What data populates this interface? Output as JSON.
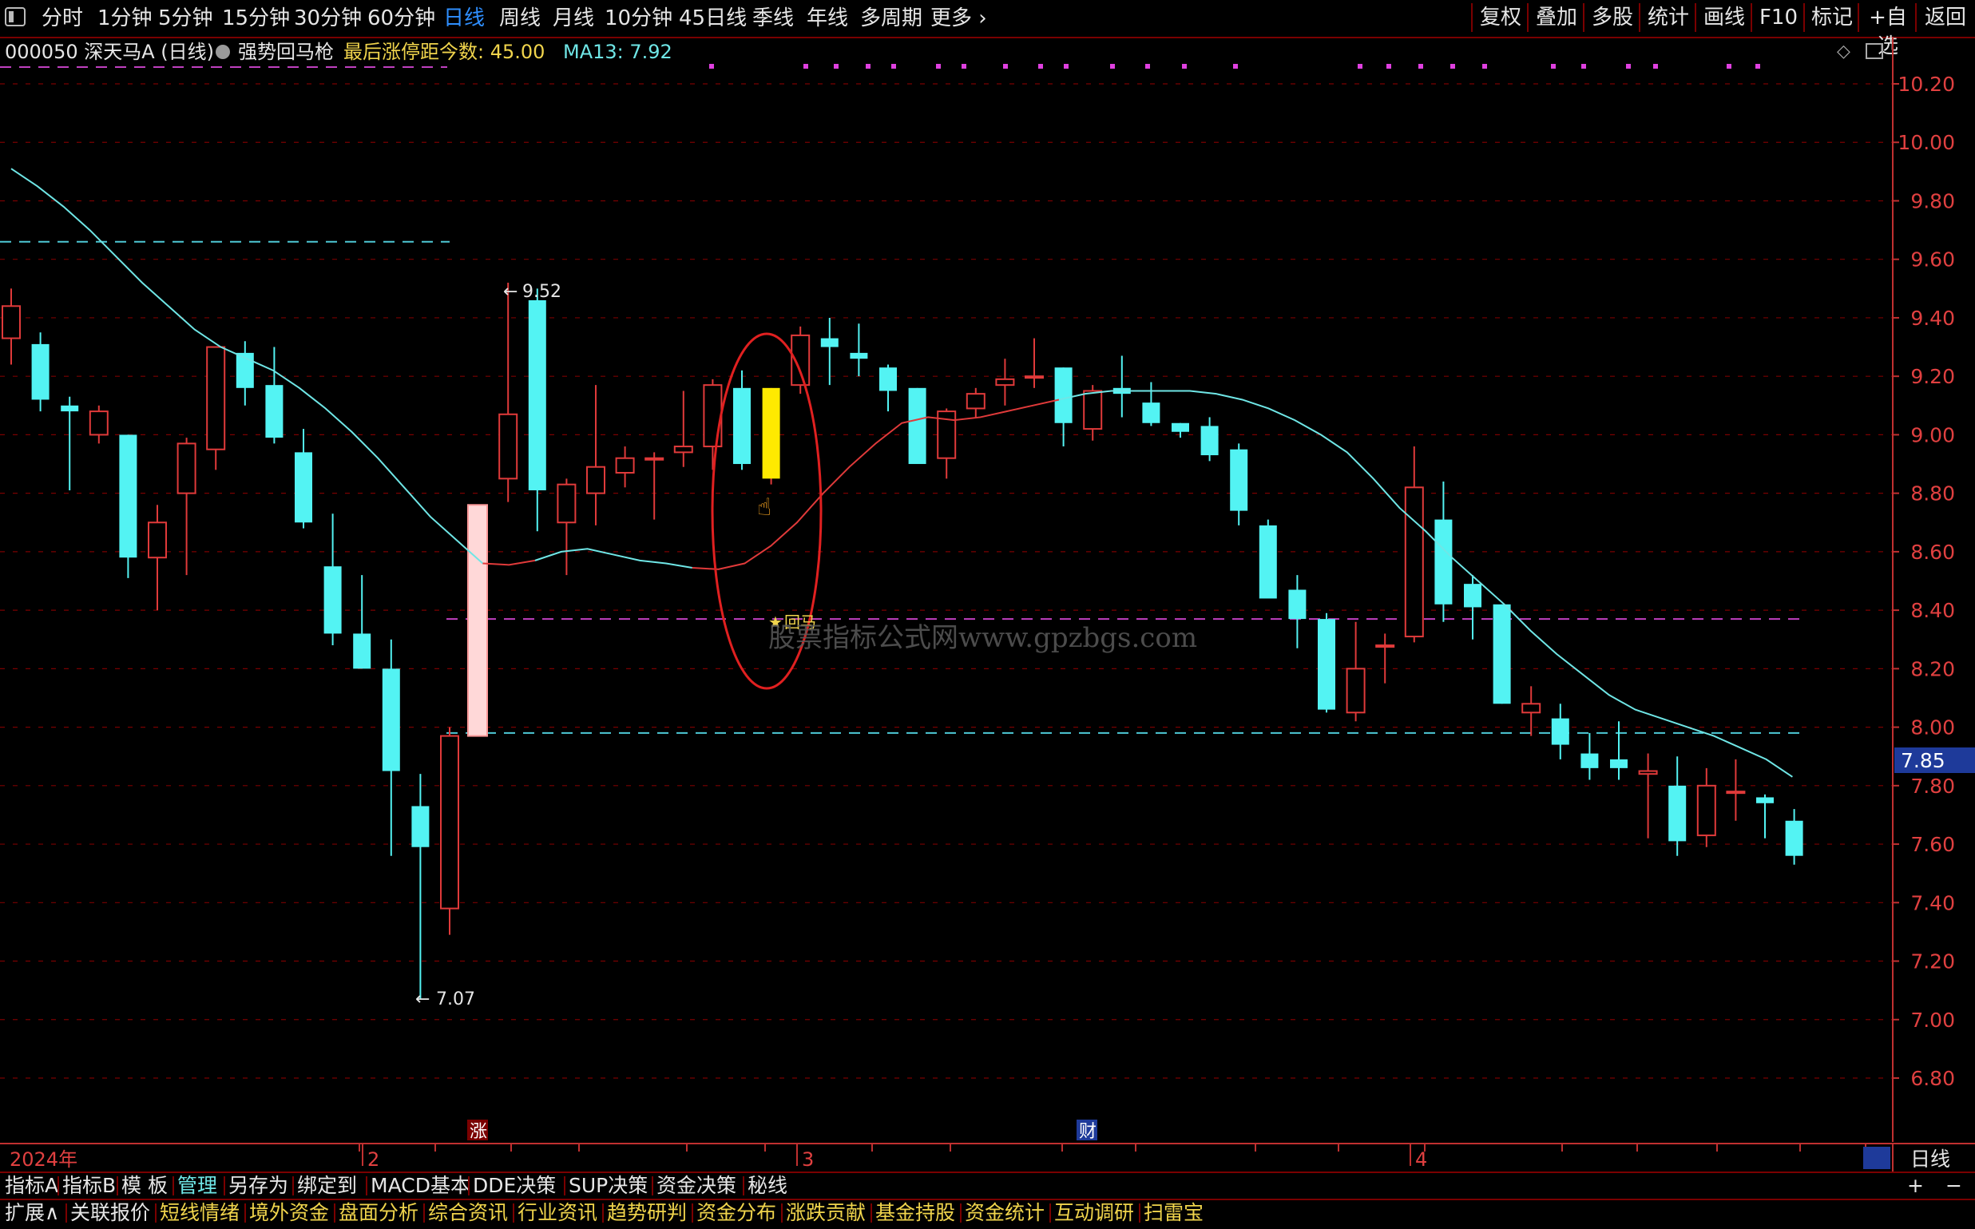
{
  "toolbar": {
    "periods": [
      {
        "label": "分时",
        "active": false
      },
      {
        "label": "1分钟",
        "active": false
      },
      {
        "label": "5分钟",
        "active": false
      },
      {
        "label": "15分钟",
        "active": false
      },
      {
        "label": "30分钟",
        "active": false
      },
      {
        "label": "60分钟",
        "active": false
      },
      {
        "label": "日线",
        "active": true
      },
      {
        "label": "周线",
        "active": false
      },
      {
        "label": "月线",
        "active": false
      },
      {
        "label": "10分钟",
        "active": false
      },
      {
        "label": "45日线",
        "active": false
      },
      {
        "label": "季线",
        "active": false
      },
      {
        "label": "年线",
        "active": false
      },
      {
        "label": "多周期",
        "active": false
      },
      {
        "label": "更多 ›",
        "active": false
      }
    ],
    "right_buttons": [
      "复权",
      "叠加",
      "多股",
      "统计",
      "画线",
      "F10",
      "标记",
      "+自选",
      "返回"
    ]
  },
  "info": {
    "stock": "000050 深天马A (日线)",
    "indicator": "强势回马枪",
    "last_limit_label": "最后涨停距今数: 45.00",
    "ma_label": "MA13: 7.92"
  },
  "chart_data": {
    "type": "candlestick",
    "ylim": [
      6.7,
      10.35
    ],
    "y_ticks": [
      10.2,
      10.0,
      9.8,
      9.6,
      9.4,
      9.2,
      9.0,
      8.8,
      8.6,
      8.4,
      8.2,
      8.0,
      7.8,
      7.6,
      7.4,
      7.2,
      7.0,
      6.8
    ],
    "year_label": "2024年",
    "month_labels": [
      "2",
      "3",
      "4"
    ],
    "current_price_tag": "7.85",
    "high_annotation": "9.52",
    "low_annotation": "7.07",
    "signal_label": "回马",
    "limit_up_marker": "涨",
    "finance_marker": "财",
    "watermark": "股票指标公式网www.gpzbgs.com",
    "candles": [
      {
        "o": 9.33,
        "h": 9.5,
        "l": 9.24,
        "c": 9.44
      },
      {
        "o": 9.31,
        "h": 9.35,
        "l": 9.08,
        "c": 9.12
      },
      {
        "o": 9.1,
        "h": 9.13,
        "l": 8.81,
        "c": 9.08
      },
      {
        "o": 9.0,
        "h": 9.1,
        "l": 8.97,
        "c": 9.08
      },
      {
        "o": 9.0,
        "h": 9.0,
        "l": 8.51,
        "c": 8.58
      },
      {
        "o": 8.58,
        "h": 8.76,
        "l": 8.4,
        "c": 8.7
      },
      {
        "o": 8.8,
        "h": 8.99,
        "l": 8.52,
        "c": 8.97
      },
      {
        "o": 8.95,
        "h": 9.3,
        "l": 8.88,
        "c": 9.3
      },
      {
        "o": 9.28,
        "h": 9.32,
        "l": 9.1,
        "c": 9.16
      },
      {
        "o": 9.17,
        "h": 9.3,
        "l": 8.97,
        "c": 8.99
      },
      {
        "o": 8.94,
        "h": 9.02,
        "l": 8.68,
        "c": 8.7
      },
      {
        "o": 8.55,
        "h": 8.73,
        "l": 8.28,
        "c": 8.32
      },
      {
        "o": 8.32,
        "h": 8.52,
        "l": 8.21,
        "c": 8.2
      },
      {
        "o": 8.2,
        "h": 8.3,
        "l": 7.56,
        "c": 7.85
      },
      {
        "o": 7.73,
        "h": 7.84,
        "l": 7.07,
        "c": 7.59
      },
      {
        "o": 7.38,
        "h": 8.0,
        "l": 7.29,
        "c": 7.97
      },
      {
        "o": 8.76,
        "h": 8.76,
        "l": 7.97,
        "c": 7.97
      },
      {
        "o": 8.85,
        "h": 9.52,
        "l": 8.77,
        "c": 9.07
      },
      {
        "o": 9.46,
        "h": 9.5,
        "l": 8.67,
        "c": 8.81
      },
      {
        "o": 8.7,
        "h": 8.85,
        "l": 8.52,
        "c": 8.83
      },
      {
        "o": 8.8,
        "h": 9.17,
        "l": 8.69,
        "c": 8.89
      },
      {
        "o": 8.87,
        "h": 8.96,
        "l": 8.82,
        "c": 8.92
      },
      {
        "o": 8.92,
        "h": 8.94,
        "l": 8.71,
        "c": 8.92
      },
      {
        "o": 8.94,
        "h": 9.15,
        "l": 8.89,
        "c": 8.96
      },
      {
        "o": 8.96,
        "h": 9.19,
        "l": 8.88,
        "c": 9.17
      },
      {
        "o": 9.16,
        "h": 9.22,
        "l": 8.88,
        "c": 8.9
      },
      {
        "o": 9.16,
        "h": 9.16,
        "l": 8.83,
        "c": 8.85,
        "highlight": true
      },
      {
        "o": 9.17,
        "h": 9.37,
        "l": 9.14,
        "c": 9.34
      },
      {
        "o": 9.33,
        "h": 9.4,
        "l": 9.17,
        "c": 9.3
      },
      {
        "o": 9.28,
        "h": 9.38,
        "l": 9.2,
        "c": 9.26
      },
      {
        "o": 9.23,
        "h": 9.24,
        "l": 9.08,
        "c": 9.15
      },
      {
        "o": 9.16,
        "h": 9.16,
        "l": 8.9,
        "c": 8.9
      },
      {
        "o": 8.92,
        "h": 9.09,
        "l": 8.85,
        "c": 9.08
      },
      {
        "o": 9.09,
        "h": 9.16,
        "l": 9.06,
        "c": 9.14
      },
      {
        "o": 9.17,
        "h": 9.26,
        "l": 9.1,
        "c": 9.19
      },
      {
        "o": 9.2,
        "h": 9.33,
        "l": 9.16,
        "c": 9.2
      },
      {
        "o": 9.23,
        "h": 9.23,
        "l": 8.96,
        "c": 9.04
      },
      {
        "o": 9.02,
        "h": 9.17,
        "l": 8.98,
        "c": 9.15
      },
      {
        "o": 9.16,
        "h": 9.27,
        "l": 9.06,
        "c": 9.14
      },
      {
        "o": 9.11,
        "h": 9.18,
        "l": 9.03,
        "c": 9.04
      },
      {
        "o": 9.04,
        "h": 9.04,
        "l": 8.99,
        "c": 9.01
      },
      {
        "o": 9.03,
        "h": 9.06,
        "l": 8.91,
        "c": 8.93
      },
      {
        "o": 8.95,
        "h": 8.97,
        "l": 8.69,
        "c": 8.74
      },
      {
        "o": 8.69,
        "h": 8.71,
        "l": 8.45,
        "c": 8.44
      },
      {
        "o": 8.47,
        "h": 8.52,
        "l": 8.27,
        "c": 8.37
      },
      {
        "o": 8.37,
        "h": 8.39,
        "l": 8.05,
        "c": 8.06
      },
      {
        "o": 8.05,
        "h": 8.36,
        "l": 8.02,
        "c": 8.2
      },
      {
        "o": 8.28,
        "h": 8.32,
        "l": 8.15,
        "c": 8.28
      },
      {
        "o": 8.31,
        "h": 8.96,
        "l": 8.29,
        "c": 8.82
      },
      {
        "o": 8.71,
        "h": 8.84,
        "l": 8.36,
        "c": 8.42
      },
      {
        "o": 8.49,
        "h": 8.52,
        "l": 8.3,
        "c": 8.41
      },
      {
        "o": 8.42,
        "h": 8.42,
        "l": 8.08,
        "c": 8.08
      },
      {
        "o": 8.05,
        "h": 8.14,
        "l": 7.97,
        "c": 8.08
      },
      {
        "o": 8.03,
        "h": 8.08,
        "l": 7.89,
        "c": 7.94
      },
      {
        "o": 7.91,
        "h": 7.98,
        "l": 7.82,
        "c": 7.86
      },
      {
        "o": 7.89,
        "h": 8.02,
        "l": 7.82,
        "c": 7.86
      },
      {
        "o": 7.84,
        "h": 7.91,
        "l": 7.62,
        "c": 7.85
      },
      {
        "o": 7.8,
        "h": 7.9,
        "l": 7.56,
        "c": 7.61
      },
      {
        "o": 7.63,
        "h": 7.86,
        "l": 7.59,
        "c": 7.8
      },
      {
        "o": 7.78,
        "h": 7.89,
        "l": 7.68,
        "c": 7.78
      },
      {
        "o": 7.76,
        "h": 7.77,
        "l": 7.62,
        "c": 7.74
      },
      {
        "o": 7.68,
        "h": 7.72,
        "l": 7.53,
        "c": 7.56
      }
    ],
    "ma13": [
      9.91,
      9.85,
      9.78,
      9.7,
      9.61,
      9.52,
      9.44,
      9.36,
      9.3,
      9.26,
      9.22,
      9.16,
      9.09,
      9.01,
      8.92,
      8.82,
      8.72,
      8.64,
      8.56,
      8.555,
      8.57,
      8.6,
      8.61,
      8.59,
      8.57,
      8.56,
      8.545,
      8.54,
      8.56,
      8.62,
      8.7,
      8.8,
      8.89,
      8.97,
      9.04,
      9.06,
      9.05,
      9.06,
      9.08,
      9.1,
      9.12,
      9.14,
      9.15,
      9.15,
      9.15,
      9.15,
      9.14,
      9.12,
      9.09,
      9.05,
      9.0,
      8.94,
      8.85,
      8.75,
      8.67,
      8.58,
      8.5,
      8.42,
      8.33,
      8.25,
      8.18,
      8.11,
      8.06,
      8.03,
      8.0,
      7.97,
      7.93,
      7.89,
      7.83
    ],
    "ma13_color_segments": [
      {
        "from": 0,
        "to": 18,
        "color": "#6fe6e6"
      },
      {
        "from": 18,
        "to": 20,
        "color": "#e03a3a"
      },
      {
        "from": 20,
        "to": 26,
        "color": "#6fe6e6"
      },
      {
        "from": 26,
        "to": 40,
        "color": "#e03a3a"
      },
      {
        "from": 40,
        "to": 68,
        "color": "#6fe6e6"
      }
    ],
    "dashed_levels": [
      {
        "value": 9.66,
        "color": "#4ec9d6",
        "from": 0,
        "to": 15
      },
      {
        "value": 8.37,
        "color": "#c040c0",
        "from": 15,
        "to": 61
      },
      {
        "value": 7.98,
        "color": "#4ec9d6",
        "from": 15,
        "to": 61
      }
    ],
    "colors": {
      "up": "#e03a3a",
      "down": "#53f3f3",
      "highlight": "#ffea00",
      "grid": "#7a0000",
      "limit_bar": "#ffd8d8"
    }
  },
  "bottom": {
    "row1": [
      "指标A",
      "指标B",
      "模 板",
      "管理",
      "另存为",
      "绑定到",
      "MACD基本",
      "DDE决策",
      "SUP决策",
      "资金决策",
      "秘线"
    ],
    "row1_active": "管理",
    "row1_right": [
      "+",
      "−"
    ],
    "row2": [
      "扩展∧",
      "关联报价",
      "短线情绪",
      "境外资金",
      "盘面分析",
      "综合资讯",
      "行业资讯",
      "趋势研判",
      "资金分布",
      "涨跌贡献",
      "基金持股",
      "资金统计",
      "互动调研",
      "扫雷宝"
    ],
    "period_label": "日线"
  }
}
